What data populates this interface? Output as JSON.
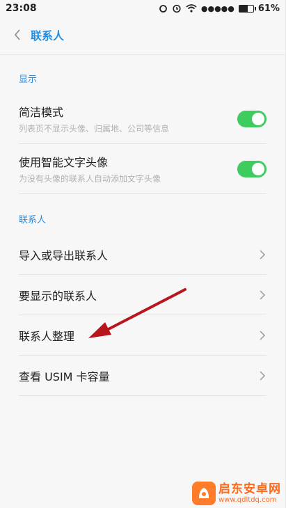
{
  "status_bar": {
    "time": "23:08",
    "signal_dots": "●●●●●",
    "battery_percent": "61%",
    "battery_level": 0.61
  },
  "header": {
    "title": "联系人"
  },
  "sections": {
    "display": {
      "label": "显示",
      "items": [
        {
          "title": "简洁模式",
          "subtitle": "列表页不显示头像、归属地、公司等信息",
          "enabled": true
        },
        {
          "title": "使用智能文字头像",
          "subtitle": "为没有头像的联系人自动添加文字头像",
          "enabled": true
        }
      ]
    },
    "contacts": {
      "label": "联系人",
      "items": [
        {
          "title": "导入或导出联系人"
        },
        {
          "title": "要显示的联系人"
        },
        {
          "title": "联系人整理"
        },
        {
          "title": "查看 USIM 卡容量"
        }
      ]
    }
  },
  "watermark": {
    "title": "启东安卓网",
    "url": "www.qdltdq.com"
  },
  "colors": {
    "accent": "#1f8fe6",
    "switch_on": "#3fcc5f",
    "annotation_arrow": "#b8161c",
    "watermark": "#ff6a1a"
  },
  "icons": {
    "back": "chevron-left-icon",
    "row": "chevron-right-icon"
  }
}
